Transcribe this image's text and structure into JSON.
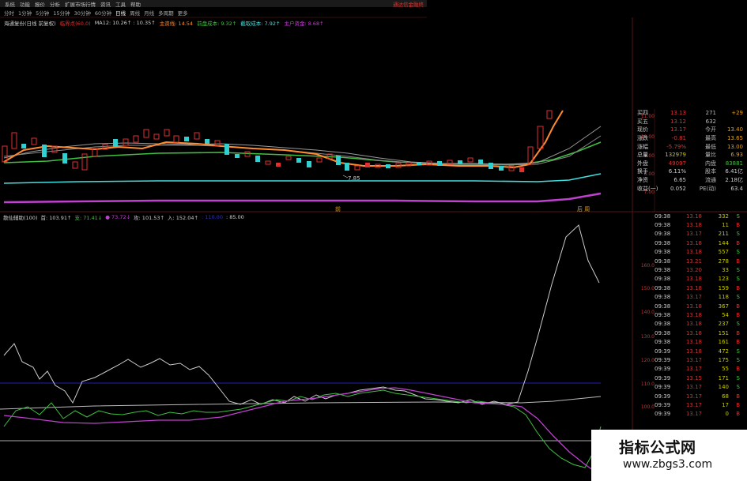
{
  "menubar": {
    "items": [
      "系统",
      "功能",
      "报价",
      "分析",
      "扩展市场行情",
      "资讯",
      "工具",
      "帮助"
    ],
    "right": "通达信金融终"
  },
  "periodbar": {
    "items": [
      "分时",
      "1分钟",
      "5分钟",
      "15分钟",
      "30分钟",
      "60分钟",
      "日线",
      "周线",
      "月线",
      "多周期",
      "更多"
    ]
  },
  "infobar": {
    "title": "海通复份(日线 前复权)",
    "ma_label": "临界点(60,0)",
    "ma_values": "MA12: 10.26↑  : 10.35↑",
    "main_line": "主资线: 14.54",
    "heavy_cost": "前盘成本: 9.32↑",
    "mid_line": "截取成本: 7.92↑",
    "main_acct": "主户资金: 8.68↑"
  },
  "chart_label_low": "7.85",
  "bottom_marks": [
    "前",
    "后 周"
  ],
  "indbar": {
    "name": "散仙辅助(100)",
    "v1": "首: 103.91↑",
    "v2": "支: 71.41↓",
    "v3": "● 73.72↓",
    "v4": "攻: 101.53↑",
    "v5": "入: 152.04↑",
    "v6": ": 110.00",
    "v7": ": 85.00"
  },
  "price_scale_top": [
    "11.00",
    "10.00",
    "9.00",
    "8.00",
    "7.00"
  ],
  "price_scale_bottom": [
    "160.0",
    "150.0",
    "140.0",
    "130.0",
    "120.0",
    "110.0",
    "100.0"
  ],
  "quote": [
    {
      "label": "买四",
      "price": "13.13",
      "vol": "271",
      "extra": "+29"
    },
    {
      "label": "买五",
      "price": "13.12",
      "vol": "632",
      "extra": ""
    },
    {
      "label": "现价",
      "price": "13.17",
      "vol": "今开",
      "extra": "13.40"
    },
    {
      "label": "涨跌",
      "price": "-0.81",
      "vol": "最高",
      "extra": "13.65"
    },
    {
      "label": "涨幅",
      "price": "-5.79%",
      "vol": "最低",
      "extra": "13.00"
    },
    {
      "label": "总量",
      "price": "132979",
      "vol": "量比",
      "extra": "6.93"
    },
    {
      "label": "外盘",
      "price": "49097",
      "vol": "内盘",
      "extra": "83881"
    },
    {
      "label": "换手",
      "price": "6.11%",
      "vol": "股本",
      "extra": "6.41亿"
    },
    {
      "label": "净资",
      "price": "6.65",
      "vol": "流通",
      "extra": "2.18亿"
    },
    {
      "label": "收益(一)",
      "price": "0.052",
      "vol": "PE(动)",
      "extra": "63.4"
    }
  ],
  "ticks": [
    {
      "t": "09:38",
      "p": "13.18",
      "v": "332",
      "s": "S"
    },
    {
      "t": "09:38",
      "p": "13.18",
      "v": "11",
      "s": "B"
    },
    {
      "t": "09:38",
      "p": "13.17",
      "v": "211",
      "s": "S"
    },
    {
      "t": "09:38",
      "p": "13.18",
      "v": "144",
      "s": "B"
    },
    {
      "t": "09:38",
      "p": "13.18",
      "v": "557",
      "s": "S"
    },
    {
      "t": "09:38",
      "p": "13.21",
      "v": "278",
      "s": "B"
    },
    {
      "t": "09:38",
      "p": "13.20",
      "v": "33",
      "s": "S"
    },
    {
      "t": "09:38",
      "p": "13.18",
      "v": "123",
      "s": "S"
    },
    {
      "t": "09:38",
      "p": "13.18",
      "v": "159",
      "s": "B"
    },
    {
      "t": "09:38",
      "p": "13.17",
      "v": "118",
      "s": "S"
    },
    {
      "t": "09:38",
      "p": "13.18",
      "v": "367",
      "s": "B"
    },
    {
      "t": "09:38",
      "p": "13.18",
      "v": "54",
      "s": "B"
    },
    {
      "t": "09:38",
      "p": "13.18",
      "v": "237",
      "s": "S"
    },
    {
      "t": "09:38",
      "p": "13.18",
      "v": "151",
      "s": "B"
    },
    {
      "t": "09:38",
      "p": "13.18",
      "v": "161",
      "s": "B"
    },
    {
      "t": "09:39",
      "p": "13.18",
      "v": "472",
      "s": "S"
    },
    {
      "t": "09:39",
      "p": "13.17",
      "v": "175",
      "s": "S"
    },
    {
      "t": "09:39",
      "p": "13.17",
      "v": "55",
      "s": "B"
    },
    {
      "t": "09:39",
      "p": "13.15",
      "v": "171",
      "s": "S"
    },
    {
      "t": "09:39",
      "p": "13.17",
      "v": "140",
      "s": "S"
    },
    {
      "t": "09:39",
      "p": "13.17",
      "v": "68",
      "s": "B"
    },
    {
      "t": "09:39",
      "p": "13.17",
      "v": "17",
      "s": "B"
    },
    {
      "t": "09:39",
      "p": "13.17",
      "v": "0",
      "s": "B"
    }
  ],
  "watermark": {
    "line1": "指标公式网",
    "line2": "www.zbgs3.com"
  },
  "colors": {
    "up": "#e03030",
    "down": "#30d0d0",
    "orange": "#ff8c30",
    "green": "#40c040",
    "cyan": "#40e0e0",
    "magenta": "#c040d0",
    "blue": "#3030c0"
  }
}
